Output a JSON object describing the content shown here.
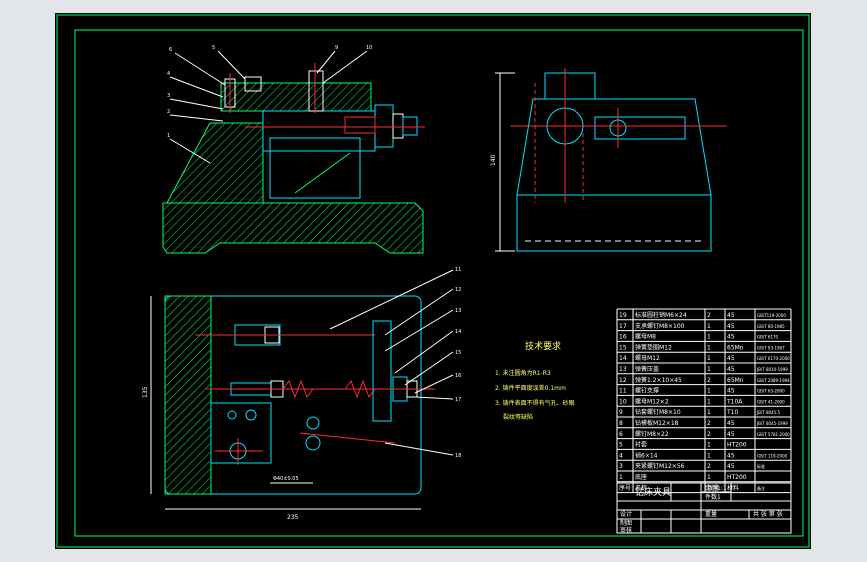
{
  "tech_requirements": {
    "title": "技术要求",
    "items": [
      "1. 未注圆角为R1-R3",
      "2. 铸件平面度误差0.1mm",
      "3. 铸件表面不得有气孔、砂眼",
      "裂纹等缺陷"
    ]
  },
  "part_labels": [
    "1",
    "2",
    "3",
    "4",
    "5",
    "6",
    "7",
    "8",
    "9",
    "10",
    "11",
    "12",
    "13",
    "14",
    "15",
    "16",
    "17",
    "18"
  ],
  "dimensions": {
    "front_height": "140",
    "top_height": "135",
    "top_width": "235",
    "top_inner": "Φ40±0.05"
  },
  "bom": [
    {
      "no": "19",
      "name": "标准圆柱销M6×24",
      "qty": "2",
      "mat": "45",
      "std": "GB/T119-2000"
    },
    {
      "no": "17",
      "name": "支承螺钉M8×100",
      "qty": "1",
      "mat": "45",
      "std": "GB/T 80-1985"
    },
    {
      "no": "16",
      "name": "螺母M8",
      "qty": "1",
      "mat": "45",
      "std": "GB/T 6170"
    },
    {
      "no": "15",
      "name": "弹簧垫圈M12",
      "qty": "1",
      "mat": "65Mn",
      "std": "GB/T 93-1987"
    },
    {
      "no": "14",
      "name": "螺母M12",
      "qty": "1",
      "mat": "45",
      "std": "GB/T 6170-2000"
    },
    {
      "no": "13",
      "name": "弹簧压盖",
      "qty": "1",
      "mat": "45",
      "std": "JB/T 8010-1999"
    },
    {
      "no": "12",
      "name": "弹簧1.2×10×45",
      "qty": "2",
      "mat": "65Mn",
      "std": "GB/T 2089-1994"
    },
    {
      "no": "11",
      "name": "螺钉支撑",
      "qty": "1",
      "mat": "45",
      "std": "GB/T 65-2000"
    },
    {
      "no": "10",
      "name": "螺母M12×2",
      "qty": "1",
      "mat": "T10A",
      "std": "GB/T 41-2000"
    },
    {
      "no": "9",
      "name": "钻套螺钉M8×10",
      "qty": "1",
      "mat": "T10",
      "std": "JB/T 8045.5"
    },
    {
      "no": "8",
      "name": "钻模板M12×18",
      "qty": "2",
      "mat": "45",
      "std": "JB/T 8045-1999"
    },
    {
      "no": "6",
      "name": "螺钉M8×22",
      "qty": "2",
      "mat": "45",
      "std": "GB/T 5781-2000"
    },
    {
      "no": "5",
      "name": "衬套",
      "qty": "1",
      "mat": "HT200",
      "std": ""
    },
    {
      "no": "4",
      "name": "销6×14",
      "qty": "1",
      "mat": "45",
      "std": "GB/T 119-2000"
    },
    {
      "no": "3",
      "name": "夹紧螺钉M12×56",
      "qty": "2",
      "mat": "45",
      "std": "标准"
    },
    {
      "no": "1",
      "name": "底座",
      "qty": "1",
      "mat": "HT200",
      "std": ""
    }
  ],
  "bom_header": {
    "no": "序号",
    "name": "名称",
    "qty": "数量",
    "mat": "材料",
    "std": "备注"
  },
  "title_block": {
    "drawing_title": "钻床夹具",
    "scale_label": "比例",
    "scale_value": "1:1",
    "qty_label": "件数",
    "qty_value": "1",
    "design_label": "设计",
    "draw_label": "制图",
    "check_label": "审核",
    "weight_label": "重量",
    "sheet_label": "共 张 第 张"
  }
}
